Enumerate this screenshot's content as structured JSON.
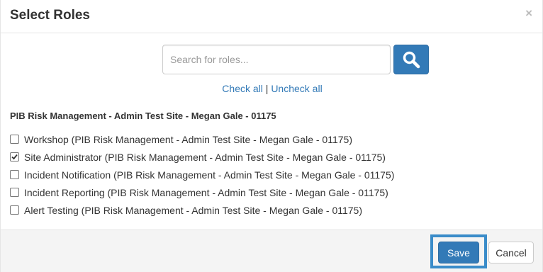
{
  "modal": {
    "title": "Select Roles",
    "close_label": "×"
  },
  "search": {
    "placeholder": "Search for roles...",
    "value": "",
    "button_icon": "search-icon"
  },
  "check_links": {
    "check_all": "Check all",
    "separator": "|",
    "uncheck_all": "Uncheck all"
  },
  "group": {
    "title": "PIB Risk Management - Admin Test Site - Megan Gale - 01175"
  },
  "roles": [
    {
      "label": "Workshop (PIB Risk Management - Admin Test Site - Megan Gale - 01175)",
      "checked": false
    },
    {
      "label": "Site Administrator (PIB Risk Management - Admin Test Site - Megan Gale - 01175)",
      "checked": true
    },
    {
      "label": "Incident Notification (PIB Risk Management - Admin Test Site - Megan Gale - 01175)",
      "checked": false
    },
    {
      "label": "Incident Reporting (PIB Risk Management - Admin Test Site - Megan Gale - 01175)",
      "checked": false
    },
    {
      "label": "Alert Testing (PIB Risk Management - Admin Test Site - Megan Gale - 01175)",
      "checked": false
    }
  ],
  "footer": {
    "save_label": "Save",
    "cancel_label": "Cancel"
  },
  "colors": {
    "primary": "#337ab7",
    "highlight": "#3a8cc9",
    "footer_bg": "#f4f4f4"
  }
}
